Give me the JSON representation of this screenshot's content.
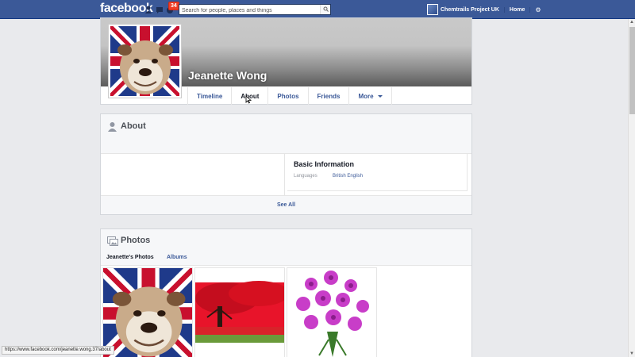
{
  "topbar": {
    "logo": "facebook",
    "notification_count": "34",
    "search_placeholder": "Search for people, places and things",
    "page_name": "Chemtrails Project UK",
    "home": "Home",
    "bg_color": "#3b5998"
  },
  "profile": {
    "name": "Jeanette Wong"
  },
  "tabs": [
    {
      "label": "Timeline"
    },
    {
      "label": "About"
    },
    {
      "label": "Photos"
    },
    {
      "label": "Friends"
    },
    {
      "label": "More"
    }
  ],
  "about": {
    "title": "About",
    "basic_info_title": "Basic Information",
    "languages_label": "Languages",
    "languages_value": "British English",
    "see_all": "See All"
  },
  "photos": {
    "title": "Photos",
    "subtab_own": "Jeanette's Photos",
    "subtab_albums": "Albums",
    "items": [
      {
        "icon": "bulldog-union-jack-photo"
      },
      {
        "icon": "red-tree-photo"
      },
      {
        "icon": "purple-orchids-photo"
      }
    ]
  },
  "statusbar": {
    "url": "https://www.facebook.com/jeanette.wong.37/about"
  }
}
